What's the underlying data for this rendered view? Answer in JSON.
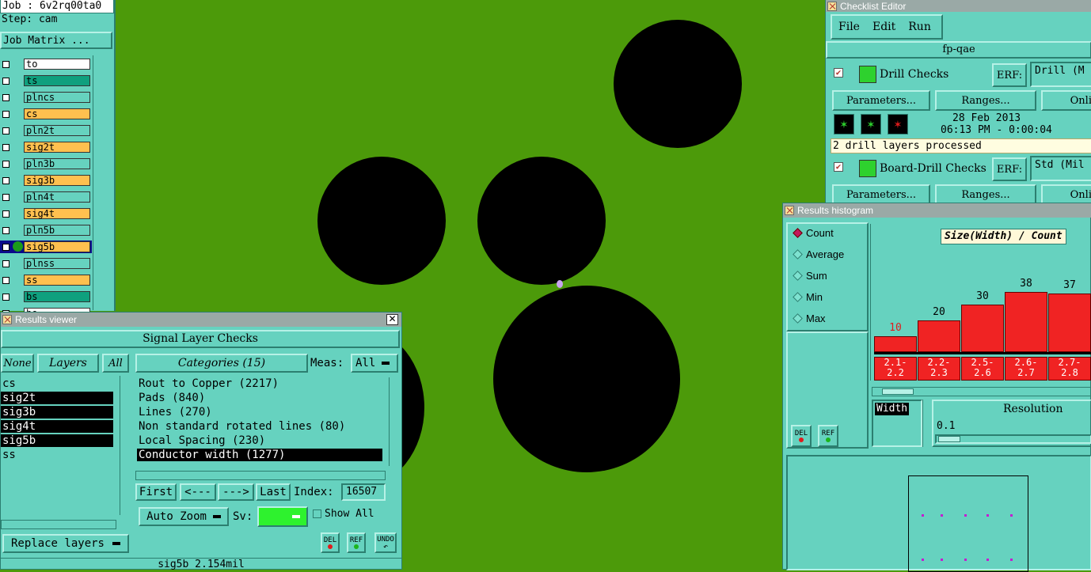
{
  "job_panel": {
    "job_line": "Job : 6v2rq00ta0",
    "step_line": "Step: cam",
    "job_matrix_button": "Job Matrix ...",
    "layers": [
      {
        "name": "to",
        "color": "#ffffff"
      },
      {
        "name": "ts",
        "color": "#0fa07e"
      },
      {
        "name": "plncs",
        "color": "#66d2bf"
      },
      {
        "name": "cs",
        "color": "#ffc04f"
      },
      {
        "name": "pln2t",
        "color": "#66d2bf"
      },
      {
        "name": "sig2t",
        "color": "#ffc04f"
      },
      {
        "name": "pln3b",
        "color": "#66d2bf"
      },
      {
        "name": "sig3b",
        "color": "#ffc04f"
      },
      {
        "name": "pln4t",
        "color": "#66d2bf"
      },
      {
        "name": "sig4t",
        "color": "#ffc04f"
      },
      {
        "name": "pln5b",
        "color": "#66d2bf"
      },
      {
        "name": "sig5b",
        "color": "#ffc04f"
      },
      {
        "name": "plnss",
        "color": "#66d2bf"
      },
      {
        "name": "ss",
        "color": "#ffc04f"
      },
      {
        "name": "bs",
        "color": "#0fa07e"
      },
      {
        "name": "bo",
        "color": "#ffffff"
      }
    ]
  },
  "results_viewer": {
    "title": "Results viewer",
    "header": "Signal Layer Checks",
    "none_button": "None",
    "layers_button": "Layers",
    "all_button": "All",
    "layer_list": [
      "cs",
      "sig2t",
      "sig3b",
      "sig4t",
      "sig5b",
      "ss"
    ],
    "categories_button": "Categories (15)",
    "meas_label": "Meas:",
    "meas_value": "All",
    "categories": [
      "Rout to Copper (2217)",
      "Pads (840)",
      "Lines (270)",
      "Non standard rotated lines (80)",
      "Local Spacing (230)",
      "Conductor width (1277)"
    ],
    "first_button": "First",
    "prev_button": "<---",
    "next_button": "--->",
    "last_button": "Last",
    "index_label": "Index:",
    "index_value": "16507",
    "auto_zoom": "Auto Zoom",
    "sv_label": "Sv:",
    "show_all": "Show All",
    "replace_layers": "Replace layers",
    "del_label": "DEL",
    "ref_label": "REF",
    "undo_label": "UNDO",
    "status": "sig5b 2.154mil"
  },
  "checklist": {
    "title": "Checklist Editor",
    "menu": [
      "File",
      "Edit",
      "Run"
    ],
    "name": "fp-qae",
    "items": [
      {
        "label": "Drill Checks",
        "erf_label": "ERF:",
        "erf_value": "Drill (M"
      },
      {
        "label": "Board-Drill Checks",
        "erf_label": "ERF:",
        "erf_value": "Std (Mil"
      }
    ],
    "parameters_button": "Parameters...",
    "ranges_button": "Ranges...",
    "online_button": "Onli",
    "date": "28 Feb 2013",
    "time": "06:13 PM - 0:00:04",
    "status": "2 drill layers processed"
  },
  "histogram": {
    "title": "Results histogram",
    "modes": [
      "Count",
      "Average",
      "Sum",
      "Min",
      "Max"
    ],
    "selected_mode": "Count",
    "chart_title": "Size(Width) / Count",
    "bars": [
      {
        "value": 10,
        "range": "2.1-\n2.2"
      },
      {
        "value": 20,
        "range": "2.2-\n2.3"
      },
      {
        "value": 30,
        "range": "2.5-\n2.6"
      },
      {
        "value": 38,
        "range": "2.6-\n2.7"
      },
      {
        "value": 37,
        "range": "2.7-\n2.8"
      }
    ],
    "width_label": "Width",
    "resolution_label": "Resolution",
    "resolution_value": "0.1",
    "del_label": "DEL",
    "ref_label": "REF"
  }
}
